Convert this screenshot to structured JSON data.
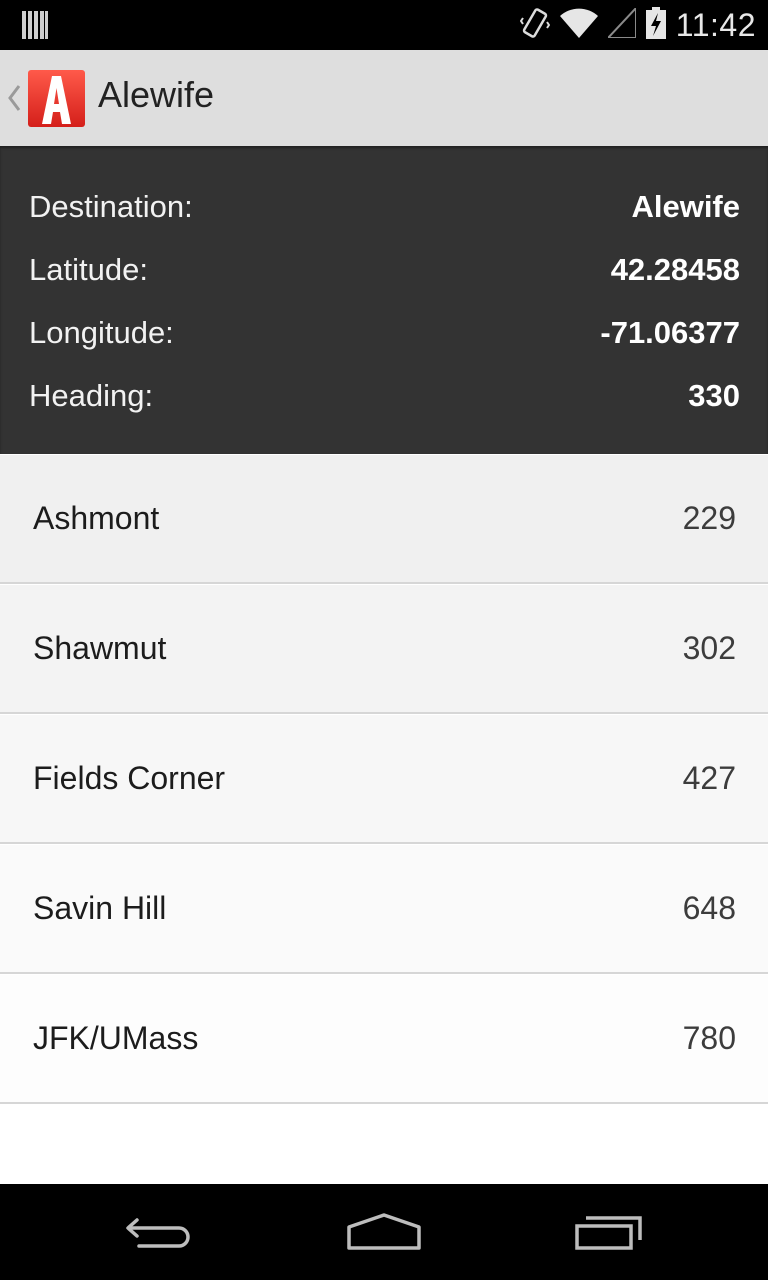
{
  "status_bar": {
    "time": "11:42",
    "icons": [
      "barcode-notification-icon",
      "vibrate-icon",
      "wifi-icon",
      "signal-icon",
      "battery-charging-icon"
    ]
  },
  "action_bar": {
    "title": "Alewife",
    "logo_letter": "A",
    "logo_color": "#e8322b"
  },
  "info": {
    "rows": [
      {
        "label": "Destination:",
        "value": "Alewife"
      },
      {
        "label": "Latitude:",
        "value": "42.28458"
      },
      {
        "label": "Longitude:",
        "value": "-71.06377"
      },
      {
        "label": "Heading:",
        "value": "330"
      }
    ]
  },
  "stations": [
    {
      "name": "Ashmont",
      "value": "229"
    },
    {
      "name": "Shawmut",
      "value": "302"
    },
    {
      "name": "Fields Corner",
      "value": "427"
    },
    {
      "name": "Savin Hill",
      "value": "648"
    },
    {
      "name": "JFK/UMass",
      "value": "780"
    }
  ],
  "nav_bar": {
    "buttons": [
      "back-icon",
      "home-icon",
      "recent-apps-icon"
    ]
  },
  "colors": {
    "info_bg": "#333333",
    "action_bar_bg": "#dedede",
    "list_bg_top": "#efefef",
    "list_bg_bottom": "#ffffff"
  }
}
